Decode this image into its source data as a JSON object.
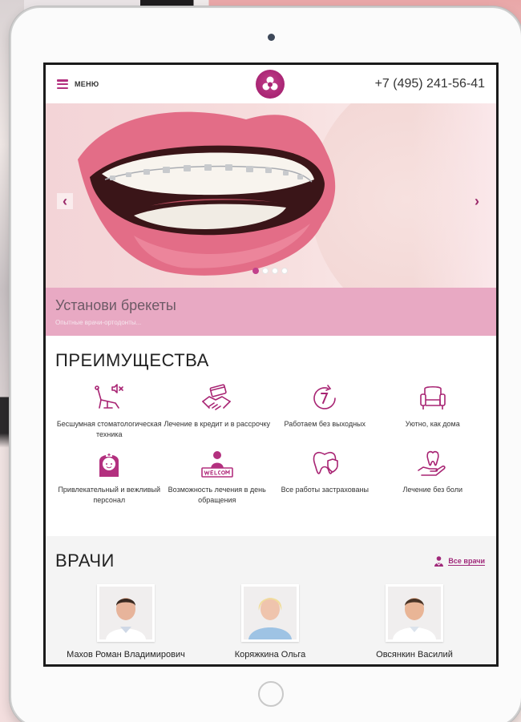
{
  "header": {
    "menu_label": "МЕНЮ",
    "phone": "+7 (495) 241-56-41"
  },
  "slider": {
    "title": "Установи брекеты",
    "subtitle": "Опытные врачи-ортодонты...",
    "prev_icon": "chevron-left-icon",
    "next_icon": "chevron-right-icon",
    "prev_glyph": "‹",
    "next_glyph": "›",
    "slide_count": 4,
    "active_slide": 1
  },
  "advantages": {
    "title": "ПРЕИМУЩЕСТВА",
    "items": [
      {
        "label": "Бесшумная стоматологическая техника",
        "icon": "dental-chair-mute-icon"
      },
      {
        "label": "Лечение в кредит и в рассрочку",
        "icon": "card-handshake-icon"
      },
      {
        "label": "Работаем без выходных",
        "icon": "clock-seven-icon"
      },
      {
        "label": "Уютно, как дома",
        "icon": "armchair-icon"
      },
      {
        "label": "Привлекательный и вежливый персонал",
        "icon": "nurse-icon"
      },
      {
        "label": "Возможность лечения в день обращения",
        "icon": "welcome-sign-icon"
      },
      {
        "label": "Все работы застрахованы",
        "icon": "tooth-shield-icon"
      },
      {
        "label": "Лечение без боли",
        "icon": "tooth-hand-icon"
      }
    ]
  },
  "doctors": {
    "title": "ВРАЧИ",
    "all_label": "Все врачи",
    "list": [
      {
        "name": "Махов Роман Владимирович"
      },
      {
        "name": "Коряжкина Ольга"
      },
      {
        "name": "Овсянкин Василий"
      }
    ]
  },
  "colors": {
    "accent": "#b3307f",
    "caption_band": "#e8a9c3"
  }
}
